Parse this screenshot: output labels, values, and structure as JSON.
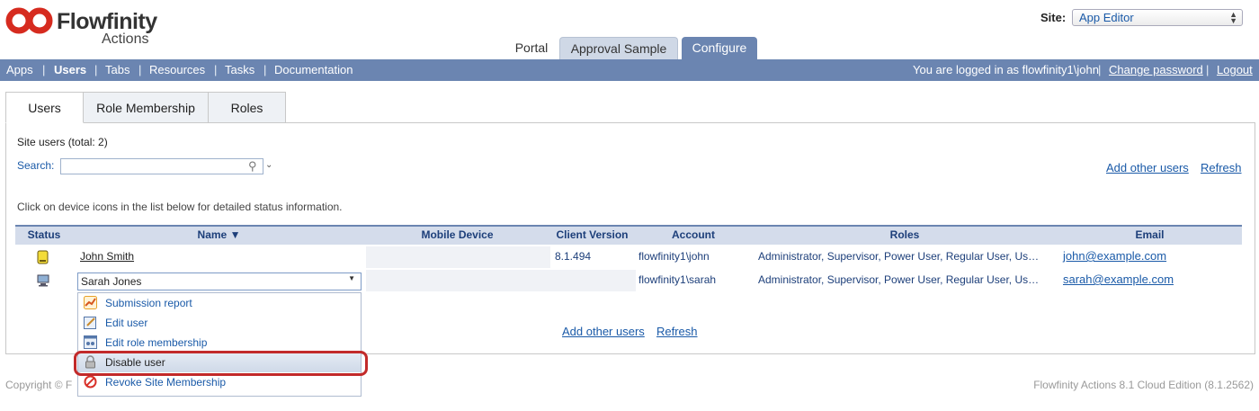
{
  "brand": {
    "name": "Flowfinity",
    "product": "Actions"
  },
  "site": {
    "label": "Site:",
    "selected": "App Editor"
  },
  "top_tabs": [
    "Portal",
    "Approval Sample",
    "Configure"
  ],
  "nav": {
    "items": [
      "Apps",
      "Users",
      "Tabs",
      "Resources",
      "Tasks",
      "Documentation"
    ],
    "logged_in": "You are logged in as flowfinity1\\john",
    "change_password": "Change password",
    "logout": "Logout"
  },
  "sub_tabs": [
    "Users",
    "Role Membership",
    "Roles"
  ],
  "summary": "Site users (total: 2)",
  "search": {
    "label": "Search:",
    "value": ""
  },
  "actions": {
    "add_other_users": "Add other users",
    "refresh": "Refresh"
  },
  "hint": "Click on device icons in the list below for detailed status information.",
  "table": {
    "columns": [
      "Status",
      "Name ▼",
      "Mobile Device",
      "Client Version",
      "Account",
      "Roles",
      "Email"
    ],
    "rows": [
      {
        "name": "John Smith",
        "device": "",
        "client_version": "8.1.494",
        "account": "flowfinity1\\john",
        "roles": "Administrator, Supervisor, Power User, Regular User, Us…",
        "email": "john@example.com",
        "status_icon": "mobile-device-icon"
      },
      {
        "name": "Sarah Jones",
        "device": "",
        "client_version": "",
        "account": "flowfinity1\\sarah",
        "roles": "Administrator, Supervisor, Power User, Regular User, Us…",
        "email": "sarah@example.com",
        "status_icon": "desktop-computer-icon"
      }
    ]
  },
  "context_menu": {
    "items": [
      {
        "label": "Submission report",
        "icon": "chart-icon"
      },
      {
        "label": "Edit user",
        "icon": "edit-icon"
      },
      {
        "label": "Edit role membership",
        "icon": "role-icon"
      },
      {
        "label": "Disable user",
        "icon": "lock-icon",
        "highlighted": true
      },
      {
        "label": "Revoke Site Membership",
        "icon": "prohibited-icon"
      }
    ]
  },
  "footer": {
    "copyright": "Copyright © F",
    "edition": "Flowfinity Actions 8.1 Cloud Edition (8.1.2562)"
  },
  "colors": {
    "accent": "#6b85b1",
    "link": "#1a5aa8",
    "highlight_ring": "#c22a2a",
    "logo_red": "#d62b1f"
  }
}
